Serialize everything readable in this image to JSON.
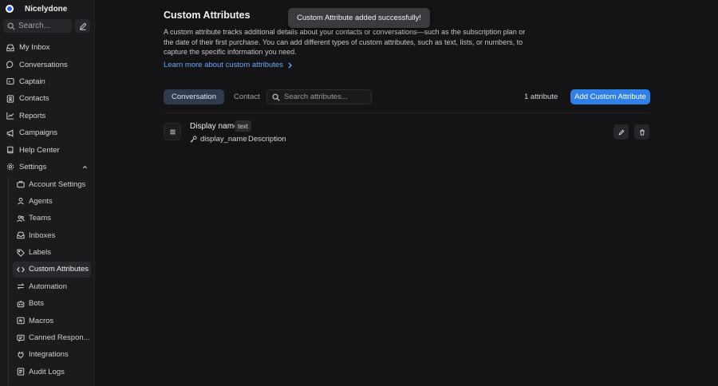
{
  "workspace": {
    "name": "Nicelydone"
  },
  "sidebar": {
    "search_placeholder": "Search...",
    "items": [
      {
        "label": "My Inbox",
        "icon": "inbox-icon"
      },
      {
        "label": "Conversations",
        "icon": "chat-bubble-icon"
      },
      {
        "label": "Captain",
        "icon": "captain-icon"
      },
      {
        "label": "Contacts",
        "icon": "contact-card-icon"
      },
      {
        "label": "Reports",
        "icon": "chart-line-icon"
      },
      {
        "label": "Campaigns",
        "icon": "megaphone-icon"
      },
      {
        "label": "Help Center",
        "icon": "book-icon"
      },
      {
        "label": "Settings",
        "icon": "gear-icon"
      }
    ],
    "settings_items": [
      {
        "label": "Account Settings",
        "icon": "briefcase-icon"
      },
      {
        "label": "Agents",
        "icon": "user-icon"
      },
      {
        "label": "Teams",
        "icon": "users-icon"
      },
      {
        "label": "Inboxes",
        "icon": "inbox-icon"
      },
      {
        "label": "Labels",
        "icon": "tag-icon"
      },
      {
        "label": "Custom Attributes",
        "icon": "code-icon"
      },
      {
        "label": "Automation",
        "icon": "arrows-icon"
      },
      {
        "label": "Bots",
        "icon": "bot-icon"
      },
      {
        "label": "Macros",
        "icon": "macro-icon"
      },
      {
        "label": "Canned Respon...",
        "icon": "canned-icon"
      },
      {
        "label": "Integrations",
        "icon": "plug-icon"
      },
      {
        "label": "Audit Logs",
        "icon": "list-icon"
      }
    ]
  },
  "page": {
    "title": "Custom Attributes",
    "description": "A custom attribute tracks additional details about your contacts or conversations—such as the subscription plan or the date of their first purchase. You can add different types of custom attributes, such as text, lists, or numbers, to capture the specific information you need.",
    "learn_more": "Learn more about custom attributes",
    "tabs": [
      "Conversation",
      "Contact"
    ],
    "search_placeholder": "Search attributes...",
    "count": "1 attribute",
    "add_button": "Add Custom Attribute"
  },
  "attribute": {
    "name": "Display name",
    "type": "text",
    "key": "display_name",
    "description": "Description"
  },
  "toast": {
    "message": "Custom Attribute added successfully!"
  },
  "colors": {
    "accent": "#2f81e8",
    "link": "#6aa6f8",
    "background": "#141416"
  }
}
